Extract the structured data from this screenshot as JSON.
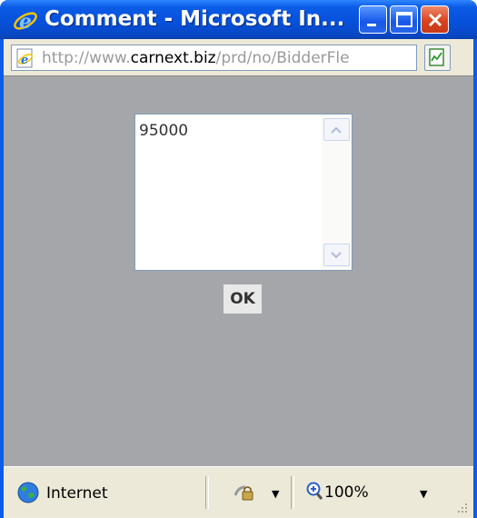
{
  "window": {
    "title": "Comment - Microsoft In...",
    "icon": "ie-logo-icon",
    "controls": [
      "minimize-icon",
      "maximize-icon",
      "close-icon"
    ]
  },
  "address": {
    "url_prefix": "http://www.",
    "url_domain": "carnext.biz",
    "url_suffix": "/prd/no/BidderFle"
  },
  "comment": {
    "value": "95000",
    "ok_label": "OK"
  },
  "status": {
    "zone": "Internet",
    "zoom": "100%"
  },
  "colors": {
    "titlebar": "#0b5ce6",
    "content_bg": "#a5a6a9",
    "chrome_bg": "#ece9d8"
  }
}
